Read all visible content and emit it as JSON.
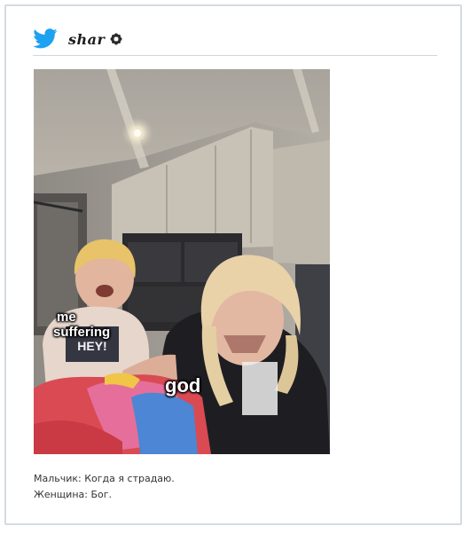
{
  "author": {
    "username": "shar",
    "avatar_icon": "flower-icon"
  },
  "brand": {
    "icon": "twitter-bird-icon",
    "color": "#1da1f2"
  },
  "media": {
    "labels": {
      "me": "me",
      "suffering": "suffering",
      "god": "god"
    },
    "shirt_text": "HEY!"
  },
  "caption": {
    "line1": "Мальчик: Когда я страдаю.",
    "line2": "Женщина: Бог."
  }
}
